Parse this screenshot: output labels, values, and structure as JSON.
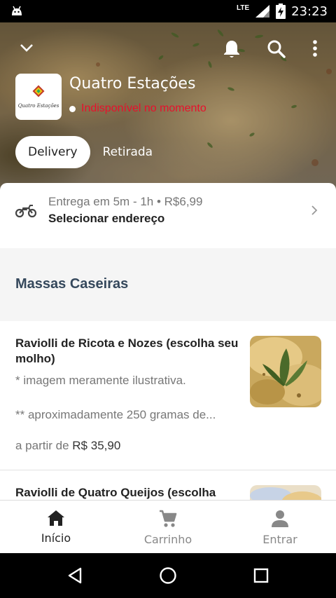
{
  "status_bar": {
    "network": "LTE",
    "time": "23:23"
  },
  "store": {
    "name": "Quatro Estações",
    "status": "Indisponível no momento",
    "logo_text": "Quatro Estações"
  },
  "modes": {
    "delivery": "Delivery",
    "pickup": "Retirada"
  },
  "delivery_info": {
    "line1": "Entrega em 5m - 1h • R$6,99",
    "line2": "Selecionar endereço"
  },
  "section": {
    "title": "Massas Caseiras"
  },
  "items": [
    {
      "name": "Raviolli de Ricota e Nozes (escolha seu molho)",
      "desc1": "* imagem meramente ilustrativa.",
      "desc2": "** aproximadamente 250 gramas de...",
      "price_prefix": "a partir de",
      "price": "R$ 35,90"
    },
    {
      "name": "Raviolli de Quatro Queijos (escolha"
    }
  ],
  "bottom_nav": {
    "home": "Início",
    "cart": "Carrinho",
    "login": "Entrar"
  },
  "colors": {
    "unavailable": "#e8102c",
    "section_title": "#35485c"
  }
}
